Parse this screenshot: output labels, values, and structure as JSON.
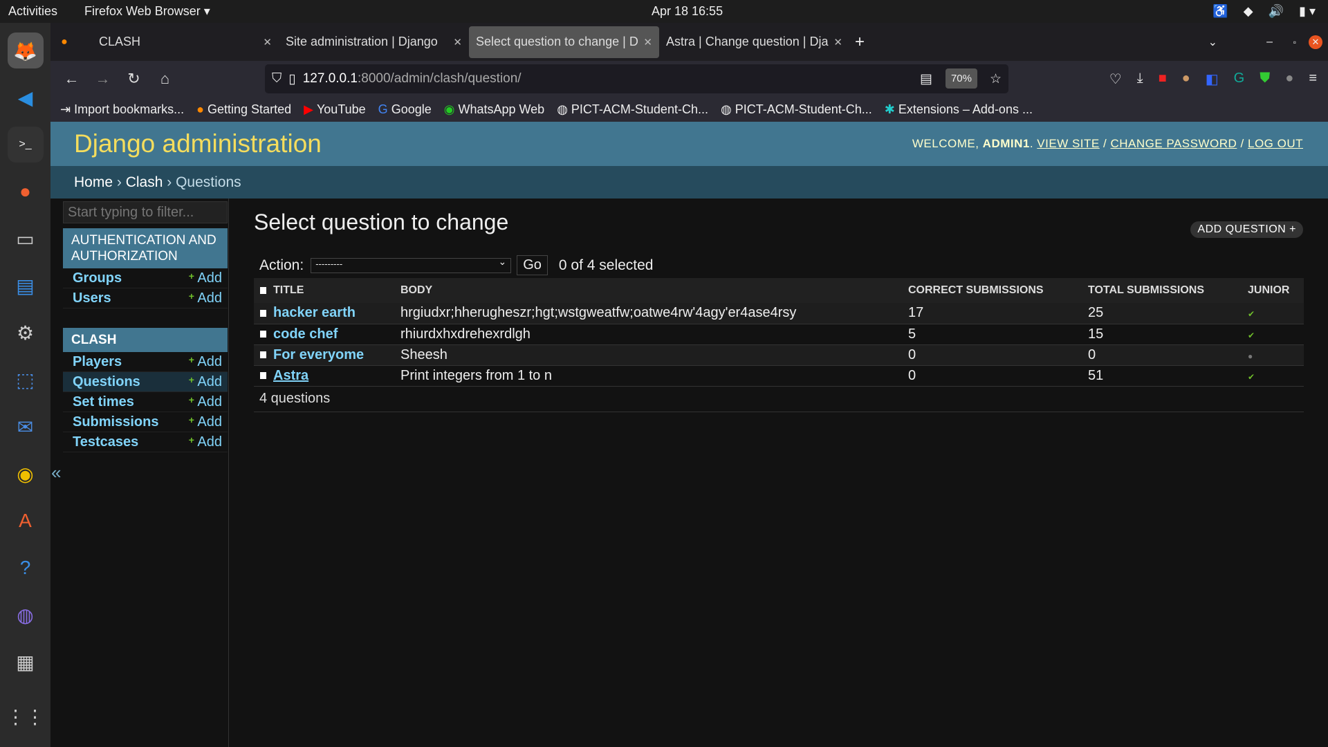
{
  "system": {
    "activities": "Activities",
    "app": "Firefox Web Browser",
    "clock": "Apr 18  16:55"
  },
  "browser": {
    "tabs": [
      {
        "label": "CLASH"
      },
      {
        "label": "Site administration | Django"
      },
      {
        "label": "Select question to change | D"
      },
      {
        "label": "Astra | Change question | Dja"
      }
    ],
    "url_host": "127.0.0.1",
    "url_path": ":8000/admin/clash/question/",
    "zoom": "70%",
    "bookmarks": [
      "Import bookmarks...",
      "Getting Started",
      "YouTube",
      "Google",
      "WhatsApp Web",
      "PICT-ACM-Student-Ch...",
      "PICT-ACM-Student-Ch...",
      "Extensions – Add-ons ..."
    ]
  },
  "header": {
    "title": "Django administration",
    "welcome": "WELCOME,",
    "user": "ADMIN1",
    "view_site": "VIEW SITE",
    "change_password": "CHANGE PASSWORD",
    "log_out": "LOG OUT"
  },
  "breadcrumbs": {
    "home": "Home",
    "app": "Clash",
    "current": "Questions"
  },
  "sidebar": {
    "filter_placeholder": "Start typing to filter...",
    "add_label": "Add",
    "modules": [
      {
        "caption": "AUTHENTICATION AND AUTHORIZATION",
        "items": [
          "Groups",
          "Users"
        ]
      },
      {
        "caption": "CLASH",
        "items": [
          "Players",
          "Questions",
          "Set times",
          "Submissions",
          "Testcases"
        ],
        "current": "Questions"
      }
    ]
  },
  "main": {
    "title": "Select question to change",
    "add_button": "ADD QUESTION +",
    "action_label": "Action:",
    "action_value": "---------",
    "go": "Go",
    "selected": "0 of 4 selected",
    "columns": [
      "TITLE",
      "BODY",
      "CORRECT SUBMISSIONS",
      "TOTAL SUBMISSIONS",
      "JUNIOR"
    ],
    "rows": [
      {
        "title": "hacker earth",
        "body": "hrgiudxr;hherugheszr;hgt;wstgweatfw;oatwe4rw'4agy'er4ase4rsy",
        "correct": "17",
        "total": "25",
        "junior": true
      },
      {
        "title": "code chef",
        "body": "rhiurdxhxdrehexrdlgh",
        "correct": "5",
        "total": "15",
        "junior": true
      },
      {
        "title": "For everyome",
        "body": "Sheesh",
        "correct": "0",
        "total": "0",
        "junior": false
      },
      {
        "title": "Astra",
        "body": "Print integers from 1 to n",
        "correct": "0",
        "total": "51",
        "junior": true
      }
    ],
    "count": "4 questions"
  },
  "colors": {
    "header": "#417690",
    "breadcrumbs": "#264b5d",
    "title": "#f5dd5d",
    "link": "#81d4fa",
    "yes": "#70bf2b"
  }
}
